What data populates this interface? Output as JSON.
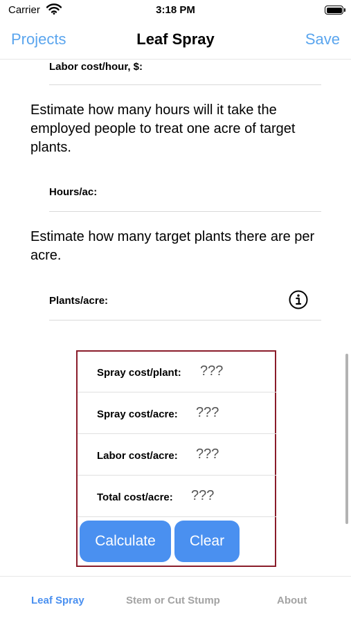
{
  "status_bar": {
    "carrier": "Carrier",
    "time": "3:18 PM"
  },
  "nav": {
    "back_label": "Projects",
    "title": "Leaf Spray",
    "save_label": "Save"
  },
  "form": {
    "labor_cost_label": "Labor cost/hour, $:",
    "hours_prompt": "Estimate how many hours will it take the employed people to treat one acre of target plants.",
    "hours_label": "Hours/ac:",
    "plants_prompt": "Estimate how many target plants there are per acre.",
    "plants_label": "Plants/acre:"
  },
  "results": [
    {
      "label": "Spray cost/plant:",
      "value": "???"
    },
    {
      "label": "Spray cost/acre:",
      "value": "???"
    },
    {
      "label": "Labor cost/acre:",
      "value": "???"
    },
    {
      "label": "Total cost/acre:",
      "value": "???"
    }
  ],
  "buttons": {
    "calculate_label": "Calculate",
    "clear_label": "Clear"
  },
  "tabs": [
    {
      "label": "Leaf Spray",
      "active": true
    },
    {
      "label": "Stem or Cut Stump",
      "active": false
    },
    {
      "label": "About",
      "active": false
    }
  ],
  "colors": {
    "accent": "#4a90f0",
    "nav_link": "#5aa5ee",
    "panel_border": "#8a1c2a"
  },
  "icons": {
    "info": "info-circle-icon",
    "wifi": "wifi-icon",
    "battery": "battery-icon"
  }
}
